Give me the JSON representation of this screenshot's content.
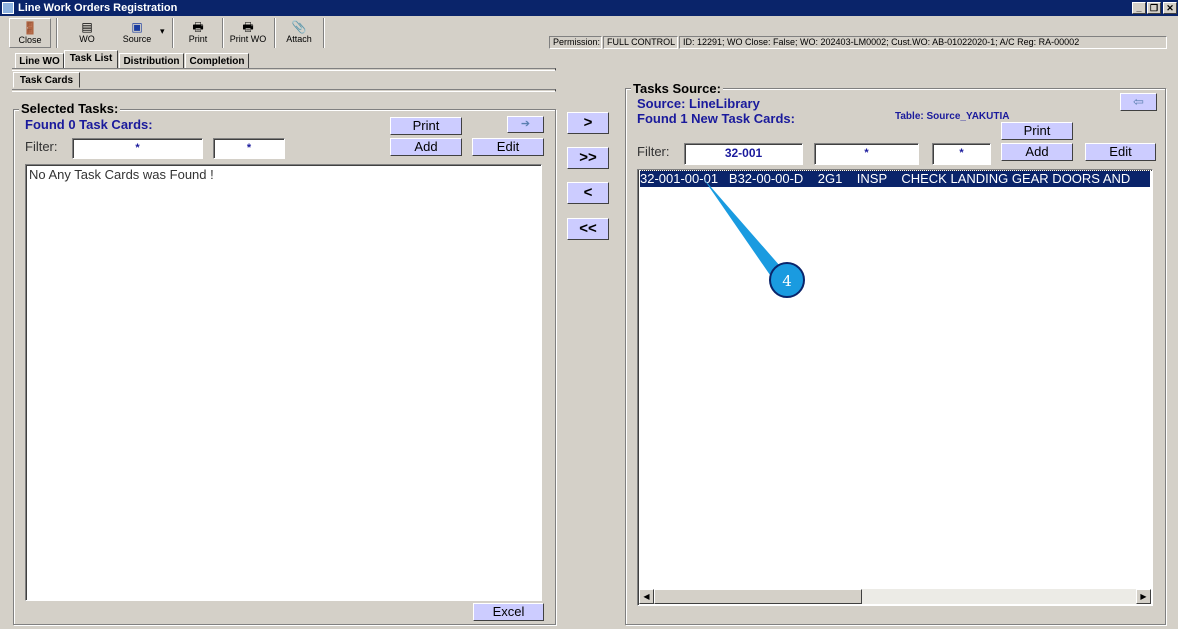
{
  "window": {
    "title": "Line Work Orders Registration",
    "min": "_",
    "max": "❐",
    "close": "✕"
  },
  "toolbar": [
    {
      "label": "Close",
      "icon": "door-exit-icon",
      "glyph": "🚪"
    },
    {
      "label": "WO",
      "icon": "wo-icon",
      "glyph": "▤"
    },
    {
      "label": "Source",
      "icon": "source-icon",
      "glyph": "▣"
    },
    {
      "label": "Print",
      "icon": "printer-icon",
      "glyph": "🖶"
    },
    {
      "label": "Print WO",
      "icon": "printer-icon",
      "glyph": "🖶"
    },
    {
      "label": "Attach",
      "icon": "attach-icon",
      "glyph": "📎"
    }
  ],
  "source_dropdown": "▾",
  "status": {
    "permission_label": "Permission:",
    "permission_value": "FULL CONTROL",
    "info": "ID: 12291; WO Close: False; WO: 202403-LM0002; Cust.WO: AB-01022020-1; A/C Reg: RA-00002"
  },
  "tabs": [
    "Line WO",
    "Task List",
    "Distribution",
    "Completion"
  ],
  "subtabs": [
    "Task Cards"
  ],
  "selected": {
    "title": "Selected Tasks:",
    "found": "Found 0 Task Cards:",
    "print": "Print",
    "arrow": "➔",
    "filter_label": "Filter:",
    "filter1": "*",
    "filter2": "*",
    "add": "Add",
    "edit": "Edit",
    "empty": "No Any Task Cards was Found !",
    "excel": "Excel"
  },
  "transfer": {
    "add_one": ">",
    "add_all": ">>",
    "remove_one": "<",
    "remove_all": "<<"
  },
  "source": {
    "title": "Tasks Source:",
    "source": "Source: LineLibrary",
    "found": "Found 1 New Task Cards:",
    "table": "Table: Source_YAKUTIA",
    "arrow": "⇦",
    "print": "Print",
    "filter_label": "Filter:",
    "filter1": "32-001",
    "filter2": "*",
    "filter3": "*",
    "add": "Add",
    "edit": "Edit",
    "rows": [
      {
        "text": "32-001-00-01   B32-00-00-D    2G1    INSP    CHECK LANDING GEAR DOORS AND"
      }
    ]
  },
  "callout": {
    "number": "4",
    "color": "#1a9be0"
  }
}
